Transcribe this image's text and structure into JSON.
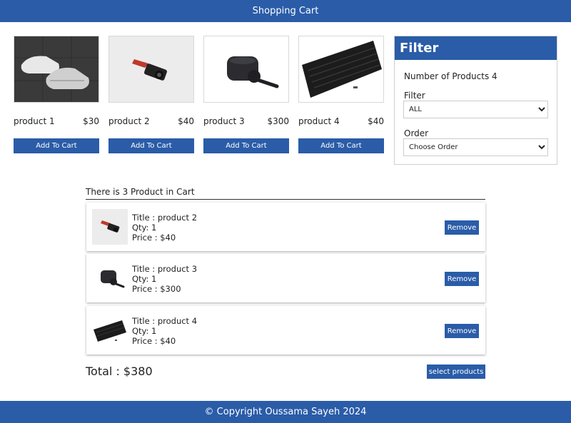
{
  "header": {
    "title": "Shopping Cart"
  },
  "products": [
    {
      "name": "product 1",
      "price": "$30",
      "button": "Add To Cart",
      "icon": "sneakers-image"
    },
    {
      "name": "product 2",
      "price": "$40",
      "button": "Add To Cart",
      "icon": "camera-image"
    },
    {
      "name": "product 3",
      "price": "$300",
      "button": "Add To Cart",
      "icon": "earbuds-image"
    },
    {
      "name": "product 4",
      "price": "$40",
      "button": "Add To Cart",
      "icon": "keyboard-image"
    }
  ],
  "filter": {
    "title": "Filter",
    "count_text": "Number of Products 4",
    "filter_label": "Filter",
    "filter_value": "ALL",
    "order_label": "Order",
    "order_value": "Choose Order"
  },
  "cart": {
    "summary": "There is 3 Product in Cart",
    "items": [
      {
        "title": "Title : product 2",
        "qty": "Qty: 1",
        "price": "Price : $40",
        "remove": "Remove",
        "icon": "camera-image"
      },
      {
        "title": "Title : product 3",
        "qty": "Qty: 1",
        "price": "Price : $300",
        "remove": "Remove",
        "icon": "earbuds-image"
      },
      {
        "title": "Title : product 4",
        "qty": "Qty: 1",
        "price": "Price : $40",
        "remove": "Remove",
        "icon": "keyboard-image"
      }
    ],
    "total": "Total : $380",
    "select_button": "select products"
  },
  "footer": {
    "text": "© Copyright Oussama Sayeh 2024"
  },
  "colors": {
    "accent": "#2a5ca8"
  }
}
